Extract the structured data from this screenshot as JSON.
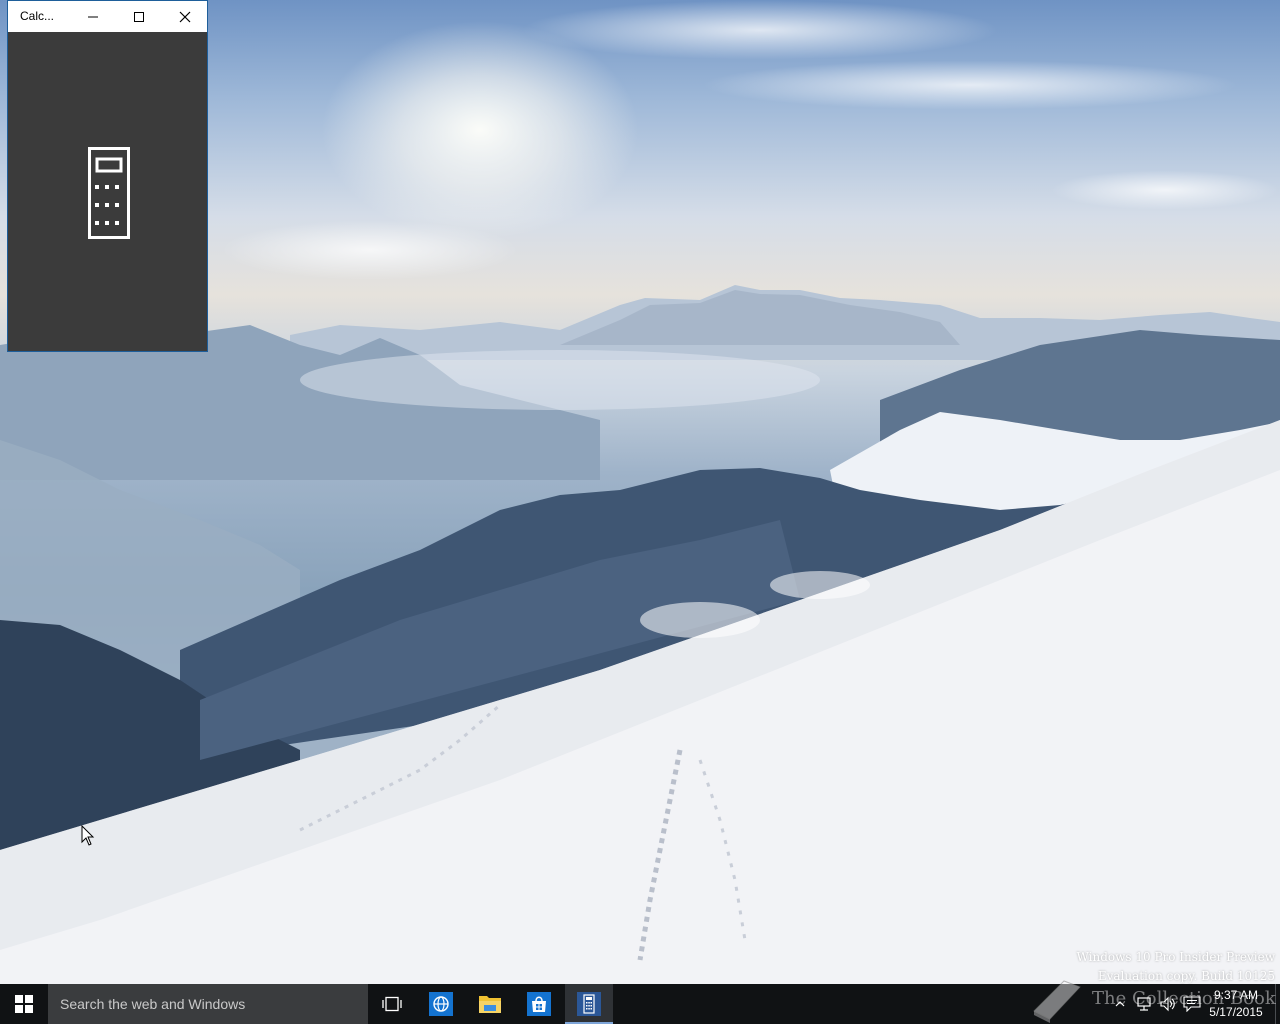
{
  "window": {
    "title": "Calc...",
    "minimize_icon": "minimize-icon",
    "maximize_icon": "maximize-icon",
    "close_icon": "close-icon",
    "splash_icon": "calculator-icon"
  },
  "desktop": {
    "watermark_line1": "Windows 10 Pro Insider Preview",
    "watermark_line2": "Evaluation copy. Build 10125"
  },
  "taskbar": {
    "start_icon": "windows-logo-icon",
    "search_placeholder": "Search the web and Windows",
    "apps": [
      {
        "name": "Task View",
        "icon": "task-view-icon"
      },
      {
        "name": "Project Spartan",
        "icon": "globe-icon"
      },
      {
        "name": "File Explorer",
        "icon": "folder-icon"
      },
      {
        "name": "Store",
        "icon": "store-icon"
      },
      {
        "name": "Calculator",
        "icon": "calculator-icon",
        "active": true
      }
    ],
    "tray": {
      "icons": [
        "chevron-up-icon",
        "network-icon",
        "volume-icon",
        "action-center-icon"
      ],
      "time": "9:37 AM",
      "date": "5/17/2015"
    }
  },
  "overlay": {
    "brand_text": "The Collection Book"
  },
  "colors": {
    "taskbar": "#101214",
    "search_box": "#3a3c3e",
    "window_body": "#3b3b3b",
    "accent": "#1e5e9a"
  }
}
